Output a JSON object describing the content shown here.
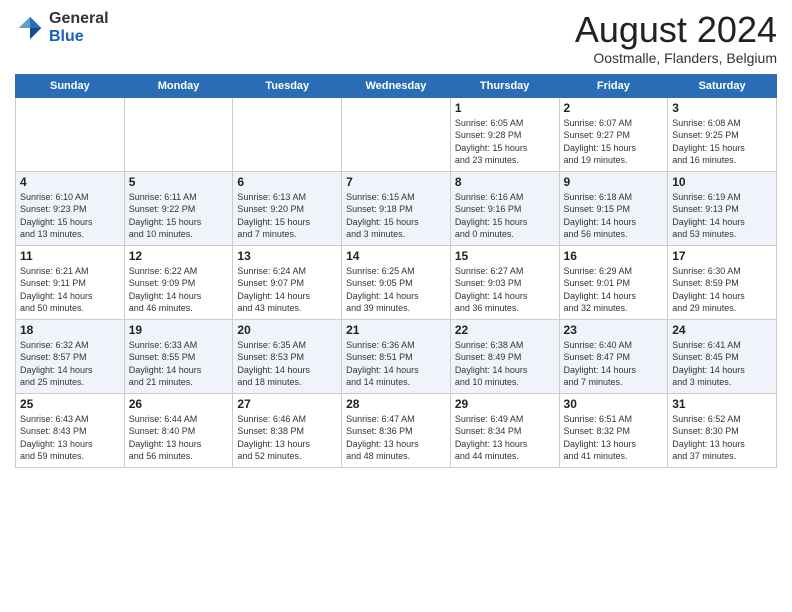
{
  "header": {
    "logo_general": "General",
    "logo_blue": "Blue",
    "month_title": "August 2024",
    "subtitle": "Oostmalle, Flanders, Belgium"
  },
  "days_of_week": [
    "Sunday",
    "Monday",
    "Tuesday",
    "Wednesday",
    "Thursday",
    "Friday",
    "Saturday"
  ],
  "weeks": [
    [
      {
        "day": "",
        "info": ""
      },
      {
        "day": "",
        "info": ""
      },
      {
        "day": "",
        "info": ""
      },
      {
        "day": "",
        "info": ""
      },
      {
        "day": "1",
        "info": "Sunrise: 6:05 AM\nSunset: 9:28 PM\nDaylight: 15 hours\nand 23 minutes."
      },
      {
        "day": "2",
        "info": "Sunrise: 6:07 AM\nSunset: 9:27 PM\nDaylight: 15 hours\nand 19 minutes."
      },
      {
        "day": "3",
        "info": "Sunrise: 6:08 AM\nSunset: 9:25 PM\nDaylight: 15 hours\nand 16 minutes."
      }
    ],
    [
      {
        "day": "4",
        "info": "Sunrise: 6:10 AM\nSunset: 9:23 PM\nDaylight: 15 hours\nand 13 minutes."
      },
      {
        "day": "5",
        "info": "Sunrise: 6:11 AM\nSunset: 9:22 PM\nDaylight: 15 hours\nand 10 minutes."
      },
      {
        "day": "6",
        "info": "Sunrise: 6:13 AM\nSunset: 9:20 PM\nDaylight: 15 hours\nand 7 minutes."
      },
      {
        "day": "7",
        "info": "Sunrise: 6:15 AM\nSunset: 9:18 PM\nDaylight: 15 hours\nand 3 minutes."
      },
      {
        "day": "8",
        "info": "Sunrise: 6:16 AM\nSunset: 9:16 PM\nDaylight: 15 hours\nand 0 minutes."
      },
      {
        "day": "9",
        "info": "Sunrise: 6:18 AM\nSunset: 9:15 PM\nDaylight: 14 hours\nand 56 minutes."
      },
      {
        "day": "10",
        "info": "Sunrise: 6:19 AM\nSunset: 9:13 PM\nDaylight: 14 hours\nand 53 minutes."
      }
    ],
    [
      {
        "day": "11",
        "info": "Sunrise: 6:21 AM\nSunset: 9:11 PM\nDaylight: 14 hours\nand 50 minutes."
      },
      {
        "day": "12",
        "info": "Sunrise: 6:22 AM\nSunset: 9:09 PM\nDaylight: 14 hours\nand 46 minutes."
      },
      {
        "day": "13",
        "info": "Sunrise: 6:24 AM\nSunset: 9:07 PM\nDaylight: 14 hours\nand 43 minutes."
      },
      {
        "day": "14",
        "info": "Sunrise: 6:25 AM\nSunset: 9:05 PM\nDaylight: 14 hours\nand 39 minutes."
      },
      {
        "day": "15",
        "info": "Sunrise: 6:27 AM\nSunset: 9:03 PM\nDaylight: 14 hours\nand 36 minutes."
      },
      {
        "day": "16",
        "info": "Sunrise: 6:29 AM\nSunset: 9:01 PM\nDaylight: 14 hours\nand 32 minutes."
      },
      {
        "day": "17",
        "info": "Sunrise: 6:30 AM\nSunset: 8:59 PM\nDaylight: 14 hours\nand 29 minutes."
      }
    ],
    [
      {
        "day": "18",
        "info": "Sunrise: 6:32 AM\nSunset: 8:57 PM\nDaylight: 14 hours\nand 25 minutes."
      },
      {
        "day": "19",
        "info": "Sunrise: 6:33 AM\nSunset: 8:55 PM\nDaylight: 14 hours\nand 21 minutes."
      },
      {
        "day": "20",
        "info": "Sunrise: 6:35 AM\nSunset: 8:53 PM\nDaylight: 14 hours\nand 18 minutes."
      },
      {
        "day": "21",
        "info": "Sunrise: 6:36 AM\nSunset: 8:51 PM\nDaylight: 14 hours\nand 14 minutes."
      },
      {
        "day": "22",
        "info": "Sunrise: 6:38 AM\nSunset: 8:49 PM\nDaylight: 14 hours\nand 10 minutes."
      },
      {
        "day": "23",
        "info": "Sunrise: 6:40 AM\nSunset: 8:47 PM\nDaylight: 14 hours\nand 7 minutes."
      },
      {
        "day": "24",
        "info": "Sunrise: 6:41 AM\nSunset: 8:45 PM\nDaylight: 14 hours\nand 3 minutes."
      }
    ],
    [
      {
        "day": "25",
        "info": "Sunrise: 6:43 AM\nSunset: 8:43 PM\nDaylight: 13 hours\nand 59 minutes."
      },
      {
        "day": "26",
        "info": "Sunrise: 6:44 AM\nSunset: 8:40 PM\nDaylight: 13 hours\nand 56 minutes."
      },
      {
        "day": "27",
        "info": "Sunrise: 6:46 AM\nSunset: 8:38 PM\nDaylight: 13 hours\nand 52 minutes."
      },
      {
        "day": "28",
        "info": "Sunrise: 6:47 AM\nSunset: 8:36 PM\nDaylight: 13 hours\nand 48 minutes."
      },
      {
        "day": "29",
        "info": "Sunrise: 6:49 AM\nSunset: 8:34 PM\nDaylight: 13 hours\nand 44 minutes."
      },
      {
        "day": "30",
        "info": "Sunrise: 6:51 AM\nSunset: 8:32 PM\nDaylight: 13 hours\nand 41 minutes."
      },
      {
        "day": "31",
        "info": "Sunrise: 6:52 AM\nSunset: 8:30 PM\nDaylight: 13 hours\nand 37 minutes."
      }
    ]
  ]
}
